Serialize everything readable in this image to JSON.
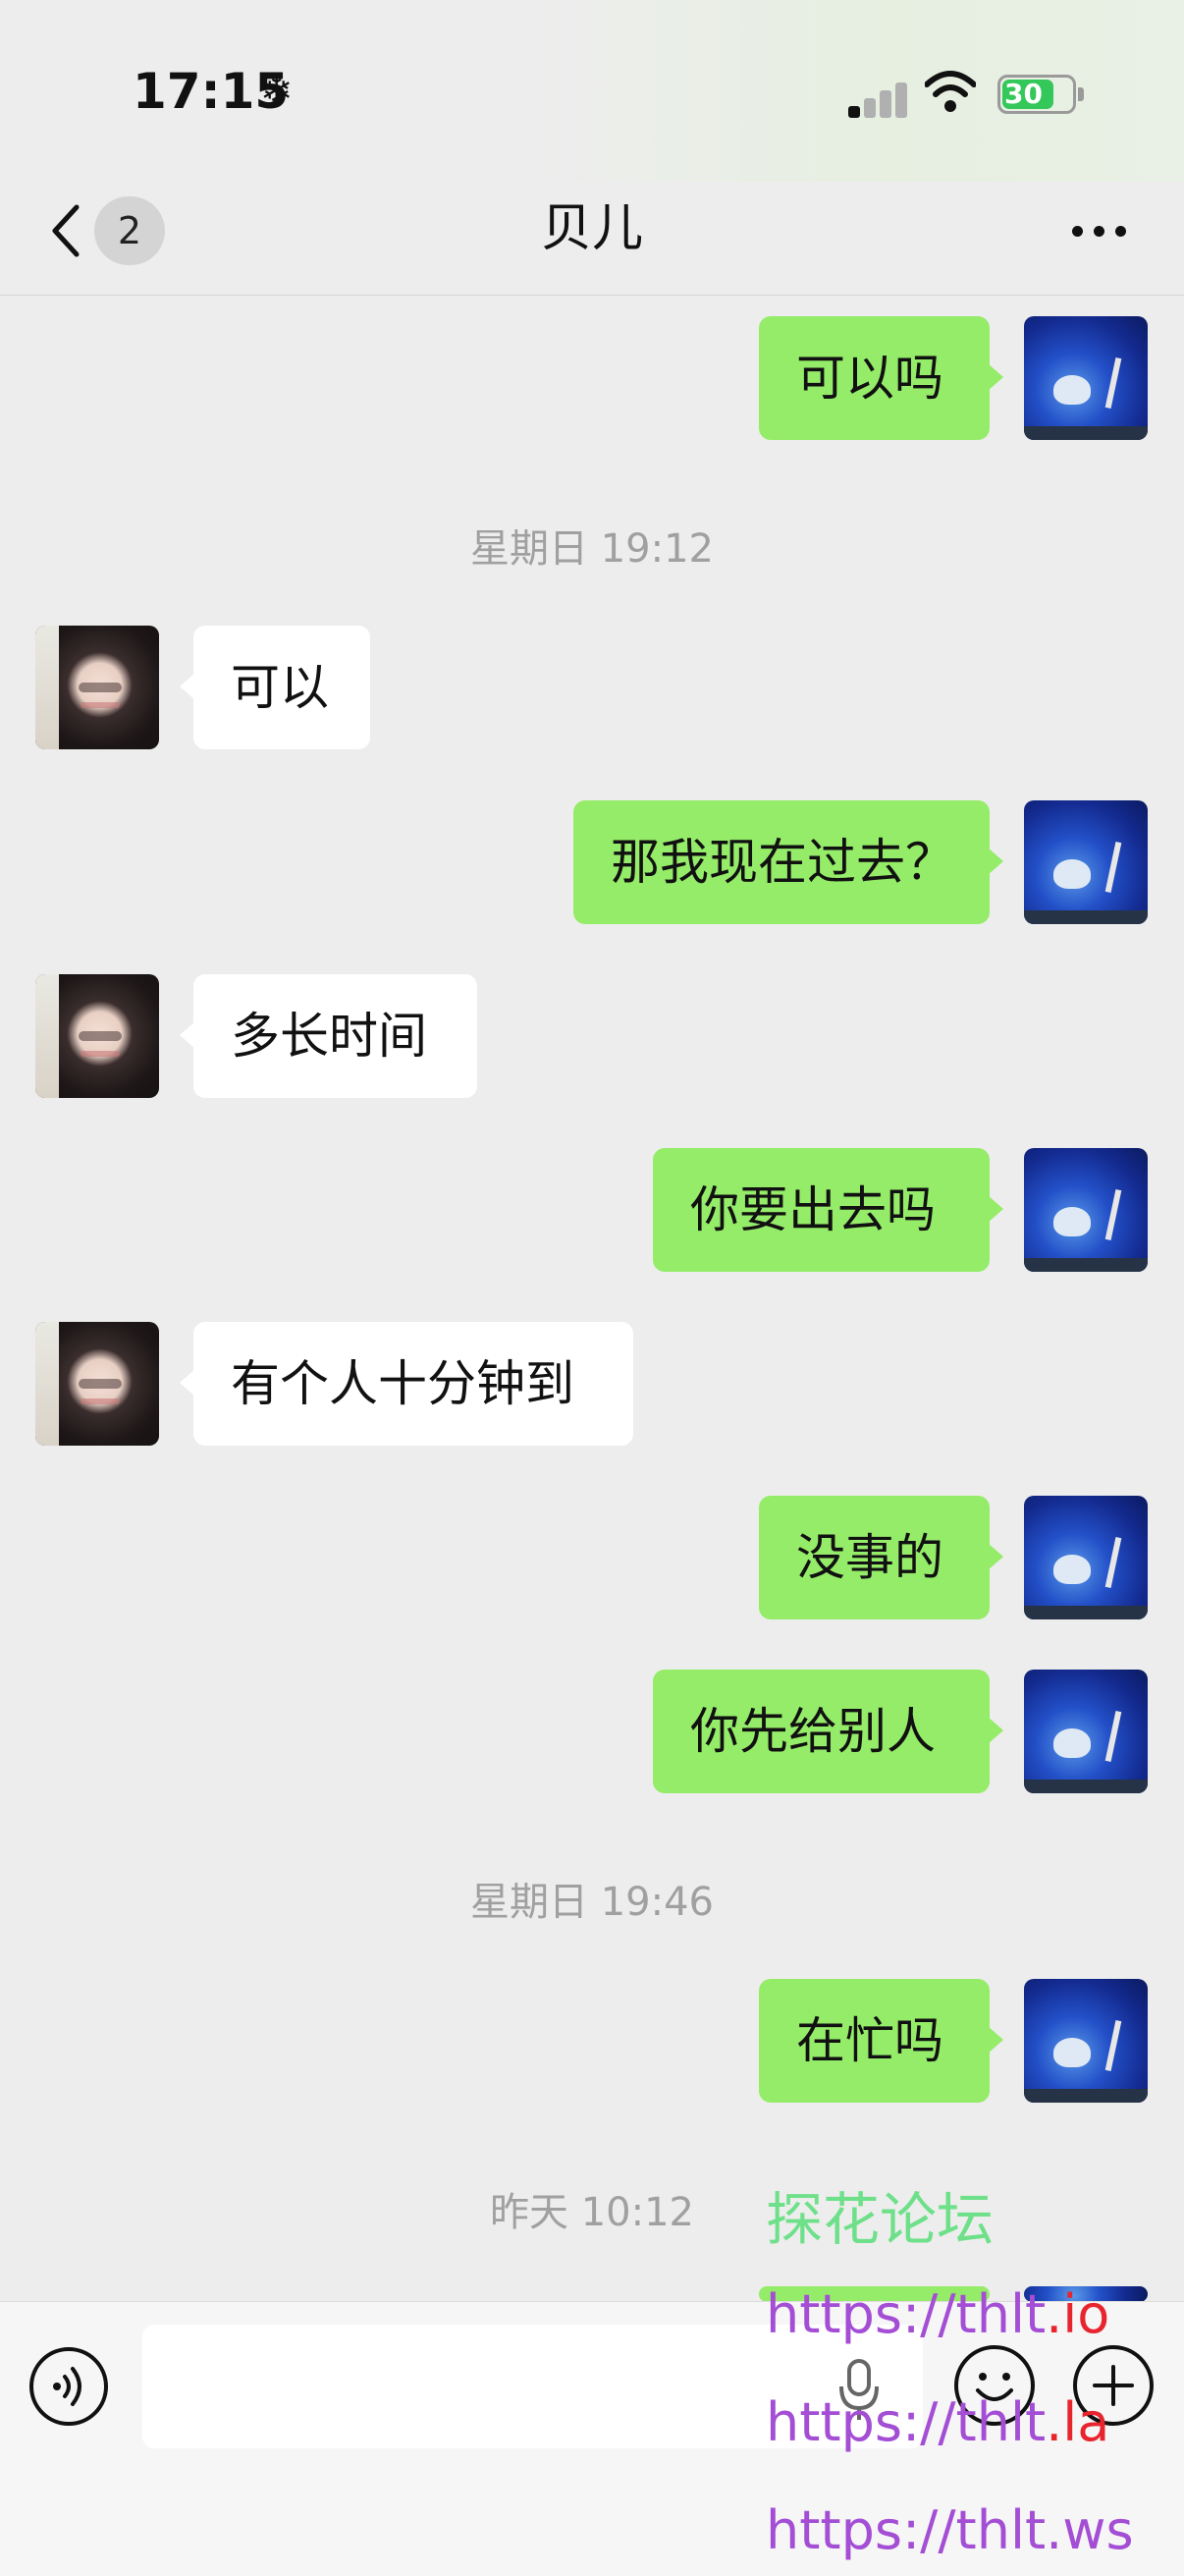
{
  "status_bar": {
    "time": "17:15",
    "battery": "30",
    "colors": {
      "battery": "#34c759"
    },
    "icons": [
      "snowflake-icon",
      "signal-icon",
      "wifi-icon",
      "battery-icon"
    ]
  },
  "nav": {
    "unread_count": "2",
    "title": "贝儿",
    "icons": [
      "back-chevron-icon",
      "more-dots-icon"
    ]
  },
  "messages": [
    {
      "sender": "self",
      "text": "可以吗"
    },
    {
      "type": "timestamp",
      "text": "星期日 19:12"
    },
    {
      "sender": "other",
      "text": "可以"
    },
    {
      "sender": "self",
      "text": "那我现在过去？"
    },
    {
      "sender": "other",
      "text": "多长时间"
    },
    {
      "sender": "self",
      "text": "你要出去吗"
    },
    {
      "sender": "other",
      "text": "有个人十分钟到"
    },
    {
      "sender": "self",
      "text": "没事的"
    },
    {
      "sender": "self",
      "text": "你先给别人"
    },
    {
      "type": "timestamp",
      "text": "星期日 19:46"
    },
    {
      "sender": "self",
      "text": "在忙吗"
    },
    {
      "type": "timestamp",
      "text": "昨天 10:12"
    }
  ],
  "colors": {
    "self_bubble": "#95ec69",
    "other_bubble": "#ffffff",
    "chat_background": "#ededed"
  },
  "input_bar": {
    "text_value": "",
    "icons": [
      "voice-icon",
      "mic-icon",
      "emoji-icon",
      "plus-icon"
    ]
  },
  "watermark": {
    "title": "探花论坛",
    "links": [
      {
        "prefix": "https://thlt",
        "tld": ".io"
      },
      {
        "prefix": "https://thlt",
        "tld": ".la"
      },
      {
        "prefix": "https://thlt",
        "tld": ".ws"
      }
    ]
  }
}
